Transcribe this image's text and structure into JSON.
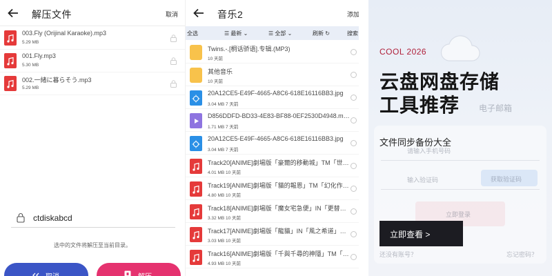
{
  "extract_panel": {
    "title": "解压文件",
    "action": "取消",
    "files": [
      {
        "name": "003.Fly (Orijinal Karaoke).mp3",
        "size": "5.29 MB"
      },
      {
        "name": "001.Fly.mp3",
        "size": "5.30 MB"
      },
      {
        "name": "002.一緒に暮らそう.mp3",
        "size": "5.29 MB"
      }
    ],
    "password": "ctdiskabcd",
    "hint": "选中的文件将解压至当前目录。",
    "cancel_label": "取消",
    "extract_label": "解压"
  },
  "music_panel": {
    "title": "音乐2",
    "action": "添加",
    "toolbar": {
      "select_all": "全选",
      "sort": "最新",
      "filter": "全部",
      "refresh": "刷新",
      "search": "搜索"
    },
    "files": [
      {
        "type": "folder",
        "name": "Twins.-.[桐话骄语].专辑.(MP3)",
        "meta": "10 天前"
      },
      {
        "type": "folder",
        "name": "其他音乐",
        "meta": "10 天前"
      },
      {
        "type": "img",
        "name": "20A12CE5-E49F-4665-A8C6-618E16116BB3.jpg",
        "meta": "3.04 MB 7 天前"
      },
      {
        "type": "video",
        "name": "D856DDFD-BD33-4E83-BF88-0EF2530D4948.mp4",
        "meta": "1.71 MB 7 天前"
      },
      {
        "type": "img",
        "name": "20A12CE5-E49F-4665-A8C6-618E16116BB3.jpg",
        "meta": "3.04 MB 7 天前"
      },
      {
        "type": "music",
        "name": "Track20[ANIME]劇場版「豪爾的移動城」TM「世…",
        "meta": "4.01 MB 10 天前"
      },
      {
        "type": "music",
        "name": "Track19[ANIME]劇場版「貓的報恩」TM「幻化作…",
        "meta": "4.80 MB 10 天前"
      },
      {
        "type": "music",
        "name": "Track18[ANIME]劇場版「魔女宅急便」IN「更替…",
        "meta": "3.32 MB 10 天前"
      },
      {
        "type": "music",
        "name": "Track17[ANIME]劇場版「龍貓」IN「風之希道」…",
        "meta": "3.03 MB 10 天前"
      },
      {
        "type": "music",
        "name": "Track16[ANIME]劇場版「千與千尋的神隱」TM「…",
        "meta": "4.93 MB 10 天前"
      }
    ]
  },
  "banner": {
    "eyebrow": "COOL 2026",
    "title": "云盘网盘存储工具推荐",
    "subtitle": "文件同步备份大全",
    "cta": "立即查看 >",
    "ghost": {
      "mail": "电子邮箱",
      "phone": "请输入手机号码",
      "code": "输入验证码",
      "get_code": "获取验证码",
      "login": "立即登录",
      "no_account": "还没有账号？",
      "forgot": "忘记密码？"
    }
  },
  "colors": {
    "music_icon": "#e53a3a",
    "folder_icon": "#f8c24b",
    "image_icon": "#2a8fe6",
    "video_icon": "#8e74e0",
    "cancel_button": "#3b55c6",
    "extract_button": "#e5326f",
    "eyebrow": "#b0203a",
    "cta_bg": "#1c1c22"
  }
}
